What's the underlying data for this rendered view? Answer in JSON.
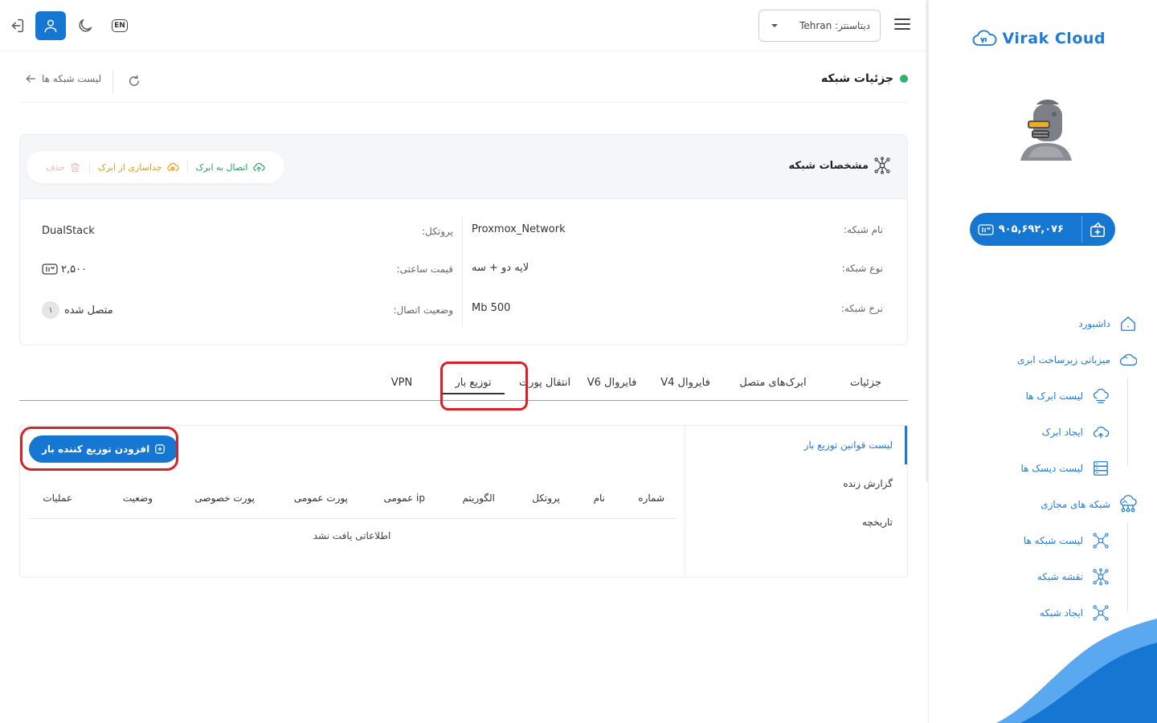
{
  "topbar": {
    "datacenter_label": "دیتاسنتر:",
    "datacenter_value": "Tehran",
    "lang": "EN"
  },
  "sidebar": {
    "logo_text": "Virak Cloud",
    "wallet_amount": "۹۰۵,۶۹۲,۰۷۶",
    "items": [
      {
        "label": "داشبورد"
      },
      {
        "label": "میزبانی زیرساخت ابری"
      },
      {
        "label": "لیست ابرک ها"
      },
      {
        "label": "ایجاد ابرک"
      },
      {
        "label": "لیست دیسک ها"
      },
      {
        "label": "شبکه های مجازی"
      },
      {
        "label": "لیست شبکه ها"
      },
      {
        "label": "نقشه شبکه"
      },
      {
        "label": "ایجاد شبکه"
      }
    ]
  },
  "header": {
    "title": "جزئیات شبکه",
    "back_label": "لیست شبکه ها"
  },
  "specs": {
    "title": "مشخصات شبکه",
    "actions": {
      "connect": "اتصال به ابرک",
      "detach": "جداسازی از ابرک",
      "delete": "حذف"
    },
    "network_name_label": "نام شبکه:",
    "network_name_value": "Proxmox_Network",
    "network_type_label": "نوع شبکه:",
    "network_type_value": "لایه دو + سه",
    "network_rate_label": "نرخ شبکه:",
    "network_rate_value": "500 Mb",
    "protocol_label": "پروتکل:",
    "protocol_value": "DualStack",
    "hourly_price_label": "قیمت ساعتی:",
    "hourly_price_value": "۲,۵۰۰",
    "connection_status_label": "وضعیت اتصال:",
    "connection_status_value": "متصل شده",
    "connection_count": "۱"
  },
  "tabs": [
    {
      "label": "جزئیات"
    },
    {
      "label": "ابرک‌های متصل"
    },
    {
      "label": "فایروال V4"
    },
    {
      "label": "فایروال V6"
    },
    {
      "label": "انتقال پورت"
    },
    {
      "label": "توزیع بار"
    },
    {
      "label": "VPN"
    }
  ],
  "lb": {
    "menu": [
      {
        "label": "لیست قوانین توزیع بار"
      },
      {
        "label": "گزارش زنده"
      },
      {
        "label": "تاریخچه"
      }
    ],
    "add_button": "افزودن توزیع کننده بار",
    "columns": [
      "شماره",
      "نام",
      "پروتکل",
      "الگوریتم",
      "ip عمومی",
      "پورت عمومی",
      "پورت خصوصی",
      "وضعیت",
      "عملیات"
    ],
    "empty_message": "اطلاعاتی یافت نشد"
  },
  "colors": {
    "brand_blue": "#1677d2",
    "success_green": "#2fb36b",
    "warning_orange": "#e8990f",
    "highlight_red": "#d6232a"
  }
}
